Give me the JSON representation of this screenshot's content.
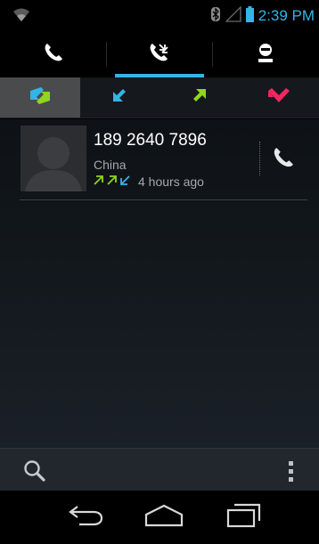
{
  "status_bar": {
    "time": "2:39 PM",
    "icons": [
      "wifi-icon",
      "bluetooth-icon",
      "signal-icon",
      "battery-icon"
    ],
    "accent": "#33b5e5"
  },
  "top_tabs": [
    {
      "name": "phone",
      "icon": "phone-icon",
      "active": false
    },
    {
      "name": "call-log",
      "icon": "call-log-icon",
      "active": true
    },
    {
      "name": "contacts",
      "icon": "contact-icon",
      "active": false
    }
  ],
  "filter_tabs": [
    {
      "name": "all",
      "icon": "all-calls-icon",
      "active": true
    },
    {
      "name": "incoming",
      "icon": "incoming-call-icon",
      "active": false,
      "color": "#33b5e5"
    },
    {
      "name": "outgoing",
      "icon": "outgoing-call-icon",
      "active": false,
      "color": "#8fd61e"
    },
    {
      "name": "missed",
      "icon": "missed-call-icon",
      "active": false,
      "color": "#f2275f"
    }
  ],
  "calls": [
    {
      "number": "189 2640 7896",
      "location": "China",
      "time": "4 hours ago",
      "types": [
        "outgoing",
        "outgoing",
        "incoming"
      ]
    }
  ],
  "action_bar": {
    "icons": [
      "search-icon",
      "overflow-menu-icon"
    ]
  },
  "nav_bar": {
    "icons": [
      "back-icon",
      "home-icon",
      "recent-apps-icon"
    ]
  }
}
